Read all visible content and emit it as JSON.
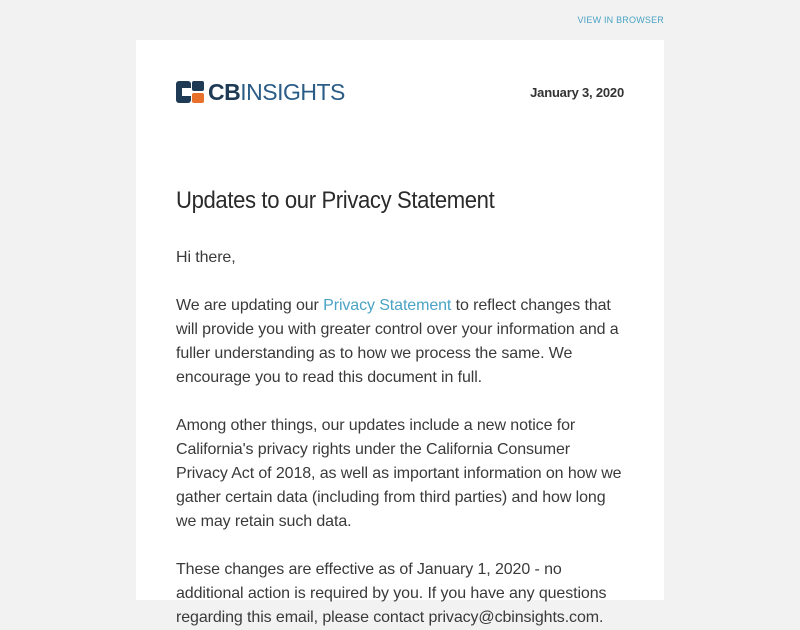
{
  "top_bar": {
    "view_in_browser": "VIEW IN BROWSER"
  },
  "colors": {
    "background": "#f2f2f2",
    "card": "#ffffff",
    "link": "#4aa3c4",
    "logo_dark": "#1f3a55",
    "logo_orange": "#e8702a"
  },
  "header": {
    "logo_cb": "CB",
    "logo_insights": "INSIGHTS",
    "date": "January 3, 2020"
  },
  "email": {
    "title": "Updates to our Privacy Statement",
    "greeting": "Hi there,",
    "p1_before": "We are updating our ",
    "p1_link": "Privacy Statement",
    "p1_after": " to reflect changes that will provide you with greater control over your information and a fuller understanding as to how we process the same. We encourage you to read this document in full.",
    "p2": "Among other things, our updates include a new notice for California's privacy rights under the California Consumer Privacy Act of 2018, as well as important information on how we gather certain data (including from third parties) and how long we may retain such data.",
    "p3": "These changes are effective as of January 1, 2020 - no additional action is required by you. If you have any questions regarding this email, please contact privacy@cbinsights.com."
  }
}
